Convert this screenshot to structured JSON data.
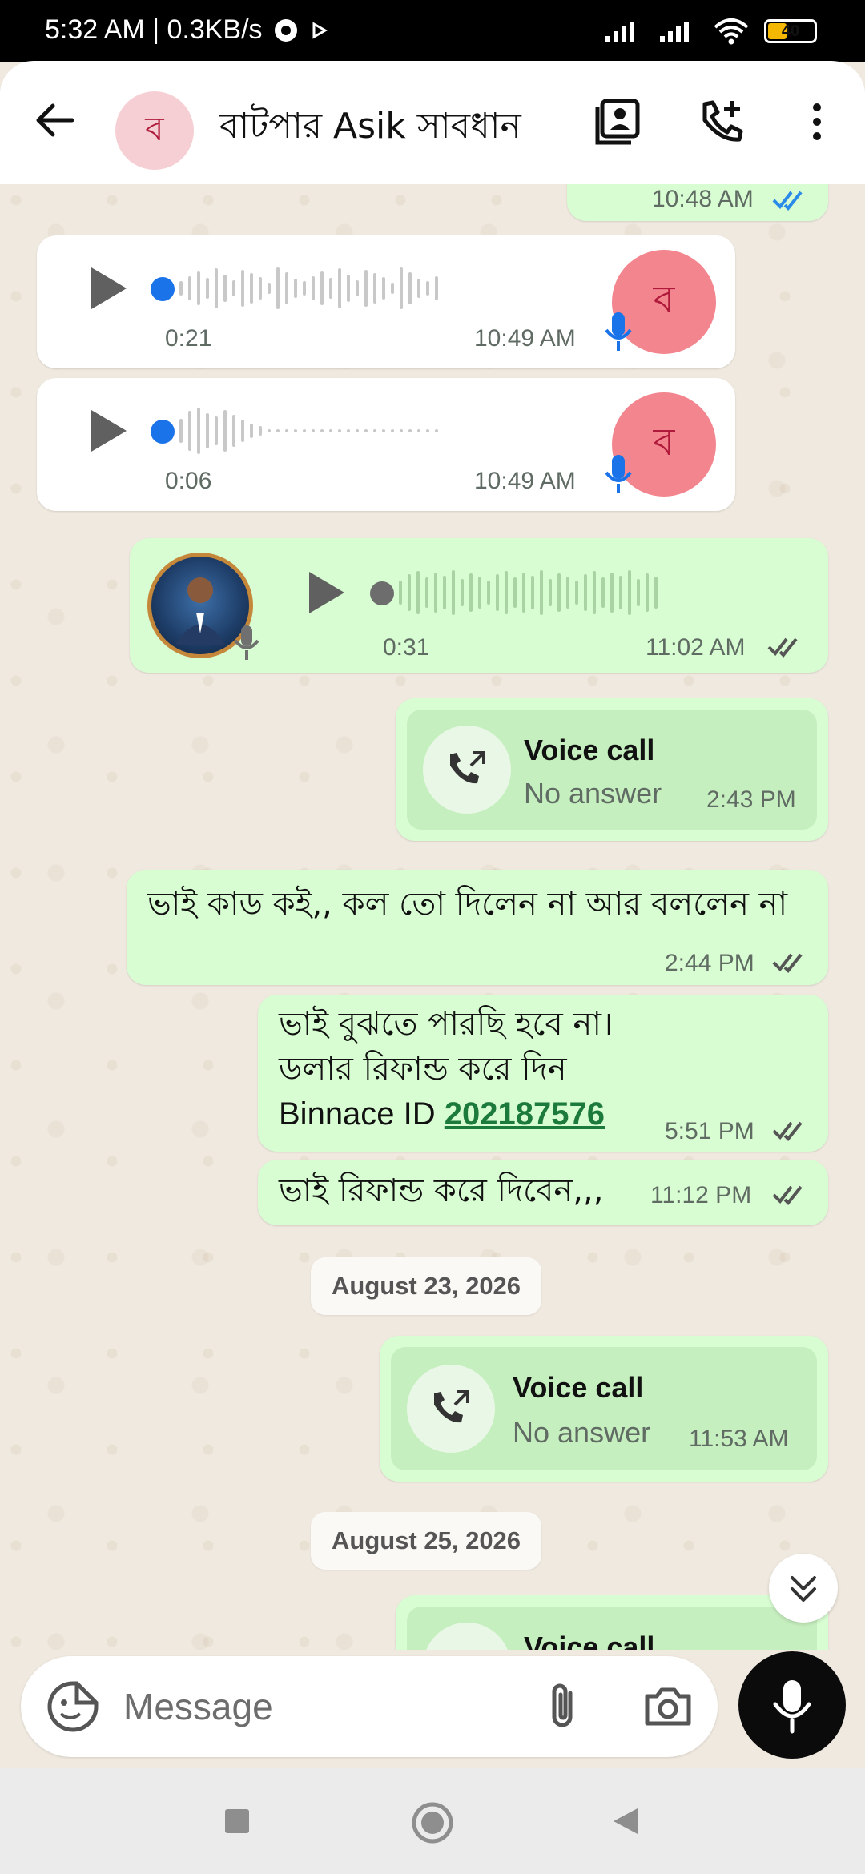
{
  "status_bar": {
    "time_speed": "5:32 AM | 0.3KB/s",
    "battery": "40"
  },
  "header": {
    "avatar_letter": "ব",
    "contact_name": "বাটপার Asik সাবধান"
  },
  "messages": {
    "top_partial_time": "10:48 AM",
    "voice1": {
      "duration": "0:21",
      "time": "10:49 AM",
      "avatar_letter": "ব"
    },
    "voice2": {
      "duration": "0:06",
      "time": "10:49 AM",
      "avatar_letter": "ব"
    },
    "voice3": {
      "duration": "0:31",
      "time": "11:02 AM"
    },
    "call1": {
      "title": "Voice call",
      "status": "No answer",
      "time": "2:43 PM"
    },
    "text1": {
      "text": "ভাই কাড কই,, কল তো দিলেন না আর বললেন না",
      "time": "2:44 PM"
    },
    "text2": {
      "line1": "ভাই বুঝতে পারছি হবে না।",
      "line2": "ডলার রিফান্ড করে দিন",
      "line3_prefix": "Binnace ID ",
      "link": "202187576",
      "time": "5:51 PM"
    },
    "text3": {
      "text": "ভাই রিফান্ড করে দিবেন,,,",
      "time": "11:12 PM"
    },
    "date1": "August 23, 2026",
    "call2": {
      "title": "Voice call",
      "status": "No answer",
      "time": "11:53 AM"
    },
    "date2": "August 25, 2026",
    "call3_partial": {
      "title": "Voice call"
    }
  },
  "input": {
    "placeholder": "Message"
  },
  "colors": {
    "outgoing_bubble": "#d8fdd2",
    "incoming_bubble": "#ffffff",
    "accent_blue": "#1a73e8",
    "link_green": "#1b7a3c",
    "tick_blue": "#2a8ae8"
  },
  "icons": [
    "back-arrow-icon",
    "contact-card-icon",
    "call-add-icon",
    "more-vert-icon",
    "play-icon",
    "mic-icon",
    "call-outgoing-icon",
    "sticker-icon",
    "attach-icon",
    "camera-icon",
    "chevron-double-down-icon",
    "nav-recents-icon",
    "nav-home-icon",
    "nav-back-icon"
  ]
}
